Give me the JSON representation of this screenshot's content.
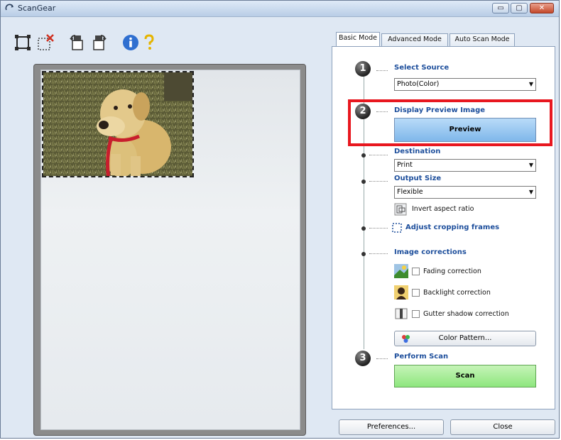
{
  "window": {
    "title": "ScanGear",
    "min_label": "▭",
    "max_label": "▢",
    "close_label": "✕"
  },
  "toolbar": {
    "icons": [
      "crop-icon",
      "delete-crop-icon",
      "rotate-left-icon",
      "rotate-right-icon",
      "info-icon",
      "help-icon"
    ]
  },
  "tabs": [
    {
      "label": "Basic Mode",
      "active": true
    },
    {
      "label": "Advanced Mode",
      "active": false
    },
    {
      "label": "Auto Scan Mode",
      "active": false
    }
  ],
  "step1": {
    "number": "1",
    "heading": "Select Source",
    "value": "Photo(Color)"
  },
  "step2": {
    "number": "2",
    "heading": "Display Preview Image",
    "button": "Preview"
  },
  "destination": {
    "heading": "Destination",
    "value": "Print"
  },
  "output_size": {
    "heading": "Output Size",
    "value": "Flexible",
    "invert_label": "Invert aspect ratio"
  },
  "crop": {
    "label": "Adjust cropping frames"
  },
  "corrections": {
    "heading": "Image corrections",
    "items": [
      {
        "label": "Fading correction",
        "checked": false
      },
      {
        "label": "Backlight correction",
        "checked": false
      },
      {
        "label": "Gutter shadow correction",
        "checked": false
      }
    ],
    "color_pattern_button": "Color Pattern..."
  },
  "step3": {
    "number": "3",
    "heading": "Perform Scan",
    "button": "Scan"
  },
  "footer": {
    "preferences": "Preferences...",
    "close": "Close"
  },
  "colors": {
    "heading_blue": "#1e4f9c",
    "preview_btn": "#7fb7ea",
    "scan_btn": "#8ee67e",
    "highlight_red": "#e8171f"
  }
}
